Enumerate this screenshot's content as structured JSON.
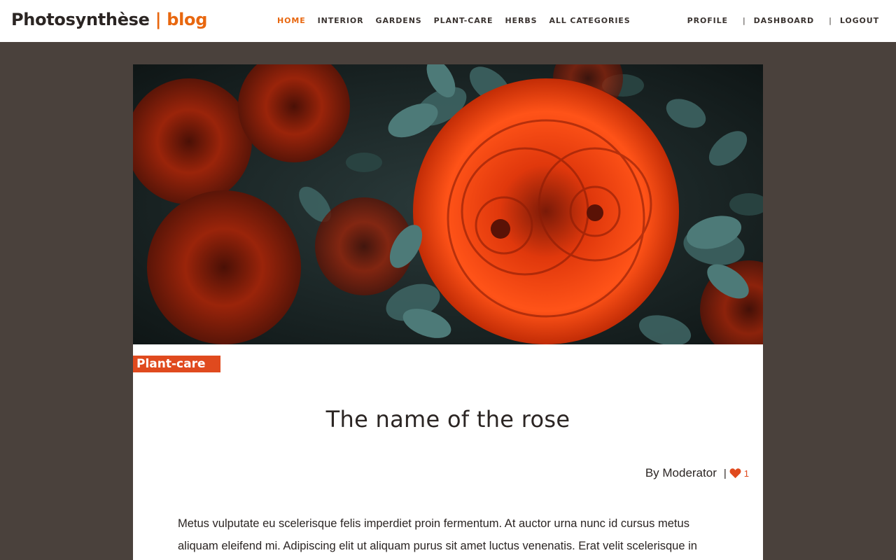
{
  "brand": {
    "name": "Photosynthèse",
    "accent": "| blog",
    "accent_color": "#e8670f"
  },
  "nav": {
    "main": [
      {
        "label": "HOME",
        "active": true
      },
      {
        "label": "INTERIOR"
      },
      {
        "label": "GARDENS"
      },
      {
        "label": "PLANT-CARE"
      },
      {
        "label": "HERBS"
      },
      {
        "label": "ALL CATEGORIES"
      }
    ],
    "user": [
      {
        "label": "PROFILE"
      },
      {
        "label": "DASHBOARD"
      },
      {
        "label": "LOGOUT"
      }
    ],
    "separator": "|"
  },
  "article": {
    "category": "Plant-care",
    "category_color": "#e04a1e",
    "title": "The name of the rose",
    "author": "By Moderator",
    "meta_separator": "|",
    "likes": "1",
    "body": "Metus vulputate eu scelerisque felis imperdiet proin fermentum. At auctor urna nunc id cursus metus aliquam eleifend mi. Adipiscing elit ut aliquam purus sit amet luctus venenatis. Erat velit scelerisque in",
    "hero_image": "red-roses-photo",
    "like_icon": "heart-icon"
  },
  "colors": {
    "page_bg": "#4a413c",
    "text": "#2b2523"
  }
}
